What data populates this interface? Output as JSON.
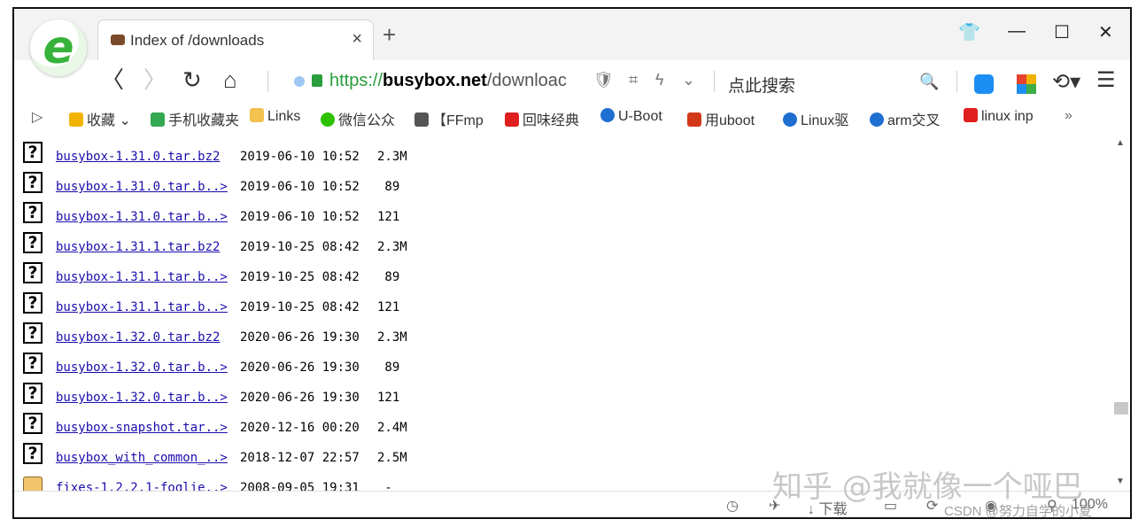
{
  "browser": {
    "tab_title": "Index of /downloads",
    "tab_close": "×",
    "new_tab": "+",
    "window_controls": {
      "skin": "👕",
      "minimize": "—",
      "maximize": "☐",
      "close": "✕"
    },
    "nav": {
      "back": "〈",
      "forward": "〉",
      "reload": "↻",
      "home": "⌂"
    },
    "url": {
      "scheme": "https://",
      "host": "busybox.net",
      "path": "/downloac"
    },
    "address_icons": {
      "shield": "🛡",
      "qr": "⌗",
      "flash": "ϟ",
      "dropdown": "⌄"
    },
    "search_text": "点此搜索",
    "search_icon": "🔍",
    "undo": "⟲▾",
    "menu": "☰"
  },
  "bookmarks": [
    {
      "label": "收藏 ⌄",
      "color": "#f0b400"
    },
    {
      "label": "手机收藏夹",
      "color": "#34a853"
    },
    {
      "label": "Links",
      "color": "#f2c14e"
    },
    {
      "label": "微信公众",
      "color": "#2dc100"
    },
    {
      "label": "【FFmp",
      "color": "#555555"
    },
    {
      "label": "回味经典",
      "color": "#e02020"
    },
    {
      "label": "U-Boot",
      "color": "#1f6fd1"
    },
    {
      "label": "用uboot",
      "color": "#d4381a"
    },
    {
      "label": "Linux驱",
      "color": "#1f6fd1"
    },
    {
      "label": "arm交叉",
      "color": "#1f6fd1"
    },
    {
      "label": "linux inp",
      "color": "#e02020"
    },
    {
      "label": "»",
      "color": ""
    }
  ],
  "bookmark_toggle": "▷",
  "files": [
    {
      "name": "busybox-1.31.0.tar.bz2",
      "date": "2019-06-10 10:52",
      "size": "2.3M",
      "icon": "unknown"
    },
    {
      "name": "busybox-1.31.0.tar.b..>",
      "date": "2019-06-10 10:52",
      "size": " 89",
      "icon": "unknown"
    },
    {
      "name": "busybox-1.31.0.tar.b..>",
      "date": "2019-06-10 10:52",
      "size": "121",
      "icon": "unknown"
    },
    {
      "name": "busybox-1.31.1.tar.bz2",
      "date": "2019-10-25 08:42",
      "size": "2.3M",
      "icon": "unknown"
    },
    {
      "name": "busybox-1.31.1.tar.b..>",
      "date": "2019-10-25 08:42",
      "size": " 89",
      "icon": "unknown"
    },
    {
      "name": "busybox-1.31.1.tar.b..>",
      "date": "2019-10-25 08:42",
      "size": "121",
      "icon": "unknown"
    },
    {
      "name": "busybox-1.32.0.tar.bz2",
      "date": "2020-06-26 19:30",
      "size": "2.3M",
      "icon": "unknown"
    },
    {
      "name": "busybox-1.32.0.tar.b..>",
      "date": "2020-06-26 19:30",
      "size": " 89",
      "icon": "unknown"
    },
    {
      "name": "busybox-1.32.0.tar.b..>",
      "date": "2020-06-26 19:30",
      "size": "121",
      "icon": "unknown"
    },
    {
      "name": "busybox-snapshot.tar..>",
      "date": "2020-12-16 00:20",
      "size": "2.4M",
      "icon": "unknown"
    },
    {
      "name": "busybox_with_common_..>",
      "date": "2018-12-07 22:57",
      "size": "2.5M",
      "icon": "unknown"
    },
    {
      "name": "fixes-1.2.2.1-foglie..>",
      "date": "2008-09-05 19:31",
      "size": " -",
      "icon": "folder"
    }
  ],
  "file_icon_glyph": "?",
  "scrollbar": {
    "up": "▲",
    "down": "▼",
    "position": 0.78
  },
  "status": {
    "download": "↓ 下载",
    "zoom": "100%"
  },
  "watermarks": {
    "main": "知乎 @我就像一个哑巴",
    "sub": "CSDN @努力自学的小夏"
  }
}
